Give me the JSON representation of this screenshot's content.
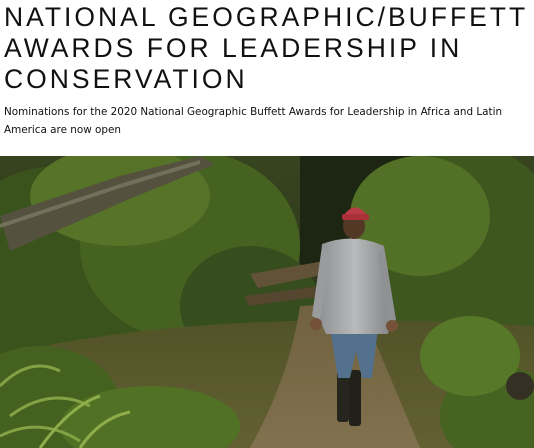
{
  "header": {
    "title_lines": [
      "NATIONAL GEOGRAPHIC/BUFFETT",
      "AWARDS FOR LEADERSHIP IN",
      "CONSERVATION"
    ],
    "subtitle": "Nominations for the 2020 National Geographic Buffett Awards for Leadership in Africa and Latin America are now open"
  },
  "hero_image": {
    "subject": "man-walking-forest-path-photo"
  }
}
